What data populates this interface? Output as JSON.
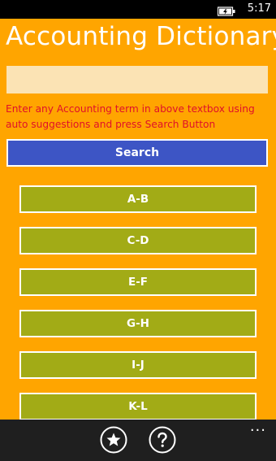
{
  "status_bar": {
    "time": "5:17",
    "battery_icon": "battery-charging-icon"
  },
  "app": {
    "title": "Accounting Dictionary"
  },
  "search": {
    "value": "",
    "placeholder": "",
    "instructions": "Enter any Accounting term in above textbox using auto suggestions and press Search Button",
    "button_label": "Search"
  },
  "letter_ranges": [
    "A-B",
    "C-D",
    "E-F",
    "G-H",
    "I-J",
    "K-L"
  ],
  "app_bar": {
    "buttons": [
      {
        "icon": "star-icon"
      },
      {
        "icon": "help-icon"
      }
    ],
    "more_label": "..."
  },
  "colors": {
    "background": "#ffa500",
    "search_button": "#3d55c5",
    "letter_button": "#a2ab16",
    "instruction_text": "#e0102a",
    "input_background": "#fbe3b4"
  }
}
